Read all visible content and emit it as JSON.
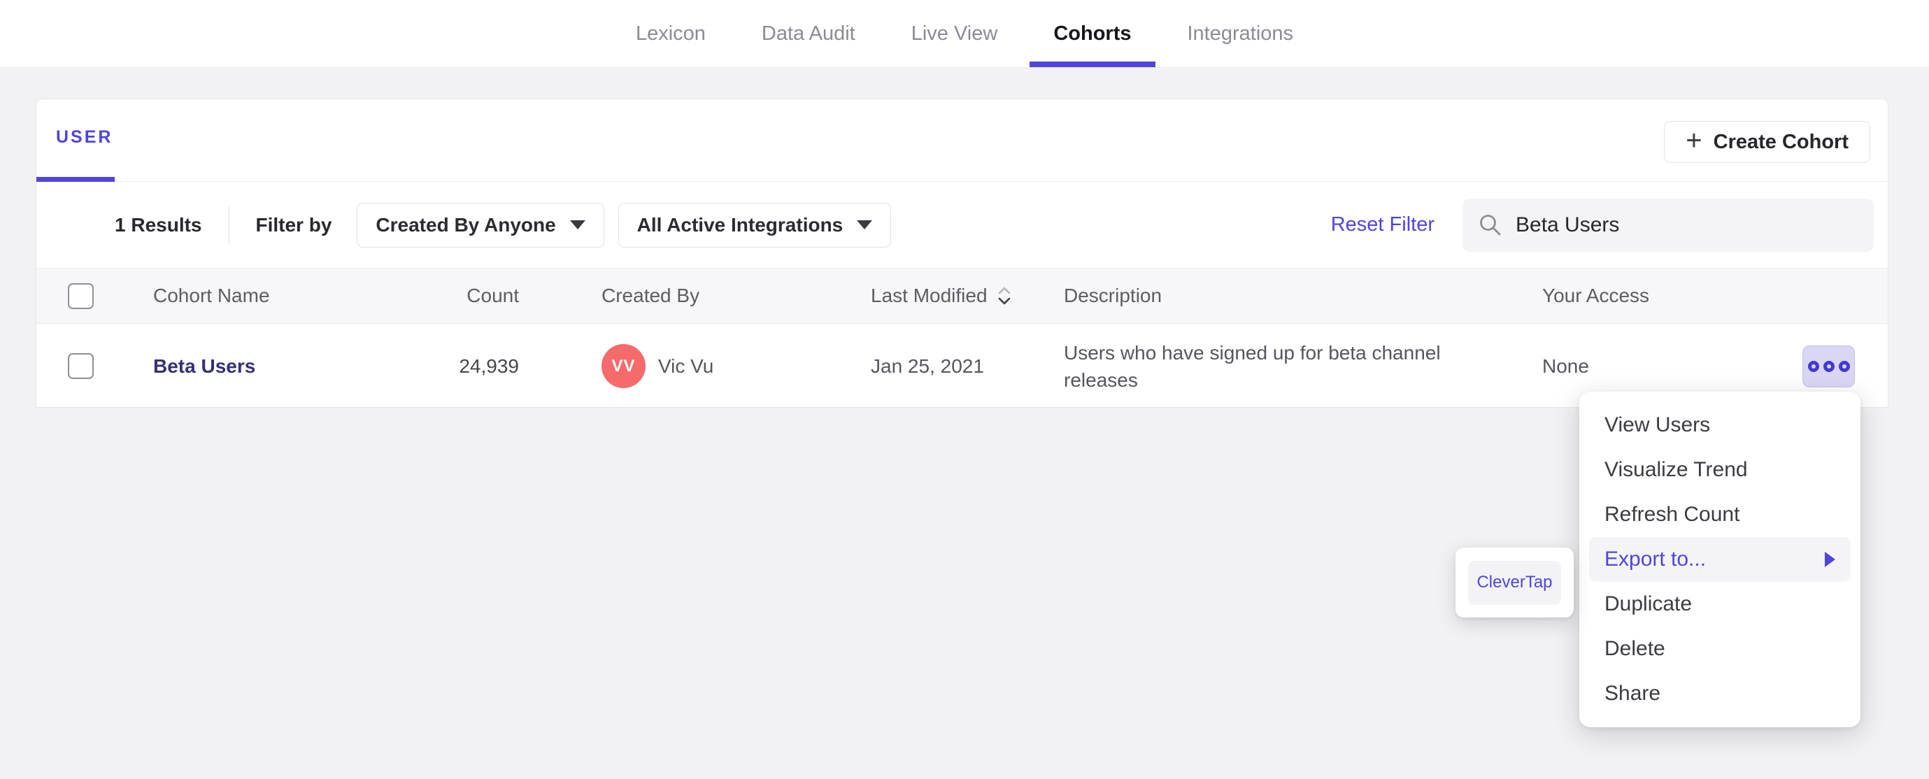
{
  "nav": {
    "items": [
      {
        "label": "Lexicon",
        "active": false
      },
      {
        "label": "Data Audit",
        "active": false
      },
      {
        "label": "Live View",
        "active": false
      },
      {
        "label": "Cohorts",
        "active": true
      },
      {
        "label": "Integrations",
        "active": false
      }
    ]
  },
  "panel": {
    "tab_label": "USER",
    "create_button": {
      "icon": "+",
      "label": "Create Cohort"
    },
    "toolbar": {
      "results": "1 Results",
      "filter_by": "Filter by",
      "created_by_dropdown": "Created By Anyone",
      "integrations_dropdown": "All Active Integrations",
      "reset_filter": "Reset Filter",
      "search_value": "Beta Users"
    },
    "table": {
      "columns": {
        "name": "Cohort Name",
        "count": "Count",
        "created_by": "Created By",
        "last_modified": "Last Modified",
        "description": "Description",
        "access": "Your Access"
      },
      "rows": [
        {
          "name": "Beta Users",
          "count": "24,939",
          "creator_initials": "VV",
          "creator_name": "Vic Vu",
          "last_modified": "Jan 25, 2021",
          "description": "Users who have signed up for beta channel releases",
          "access": "None"
        }
      ]
    }
  },
  "context_menu": {
    "items": [
      "View Users",
      "Visualize Trend",
      "Refresh Count",
      "Export to...",
      "Duplicate",
      "Delete",
      "Share"
    ],
    "highlighted_item": "Export to..."
  },
  "export_submenu": {
    "items": [
      "CleverTap"
    ]
  },
  "colors": {
    "accent": "#4f44e0",
    "cohort_link": "#343174",
    "avatar": "#f56b6b"
  }
}
